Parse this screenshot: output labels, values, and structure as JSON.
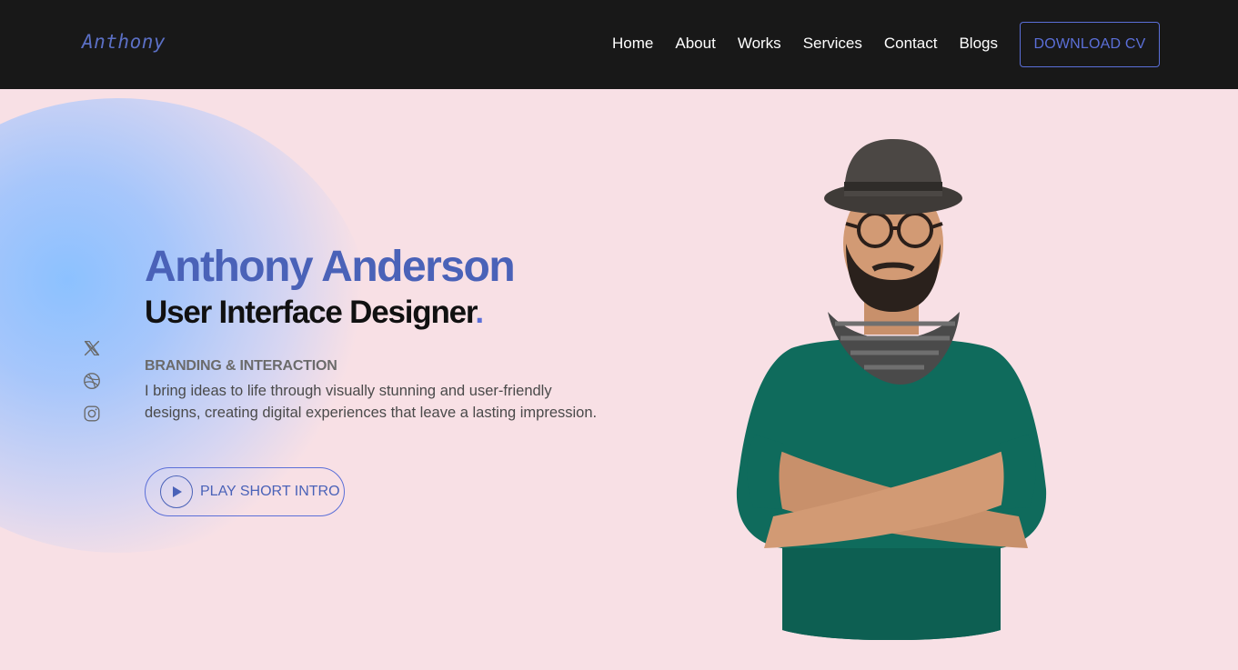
{
  "nav": {
    "logo": "Anthony",
    "items": [
      {
        "label": "Home"
      },
      {
        "label": "About"
      },
      {
        "label": "Works"
      },
      {
        "label": "Services"
      },
      {
        "label": "Contact"
      },
      {
        "label": "Blogs"
      }
    ],
    "cta": "DOWNLOAD CV"
  },
  "hero": {
    "name": "Anthony Anderson",
    "role": "User Interface Designer",
    "role_dot": ".",
    "tagline": "BRANDING & INTERACTION",
    "description": "I bring ideas to life through visually stunning and user-friendly designs, creating digital experiences that leave a lasting impression.",
    "intro_button": "PLAY SHORT INTRO"
  },
  "socials": [
    {
      "icon": "x-icon"
    },
    {
      "icon": "dribbble-icon"
    },
    {
      "icon": "instagram-icon"
    }
  ],
  "colors": {
    "accent": "#4a62b8",
    "nav_bg": "#181818",
    "page_bg": "#f8e0e5",
    "sweater": "#0f6b5c"
  }
}
